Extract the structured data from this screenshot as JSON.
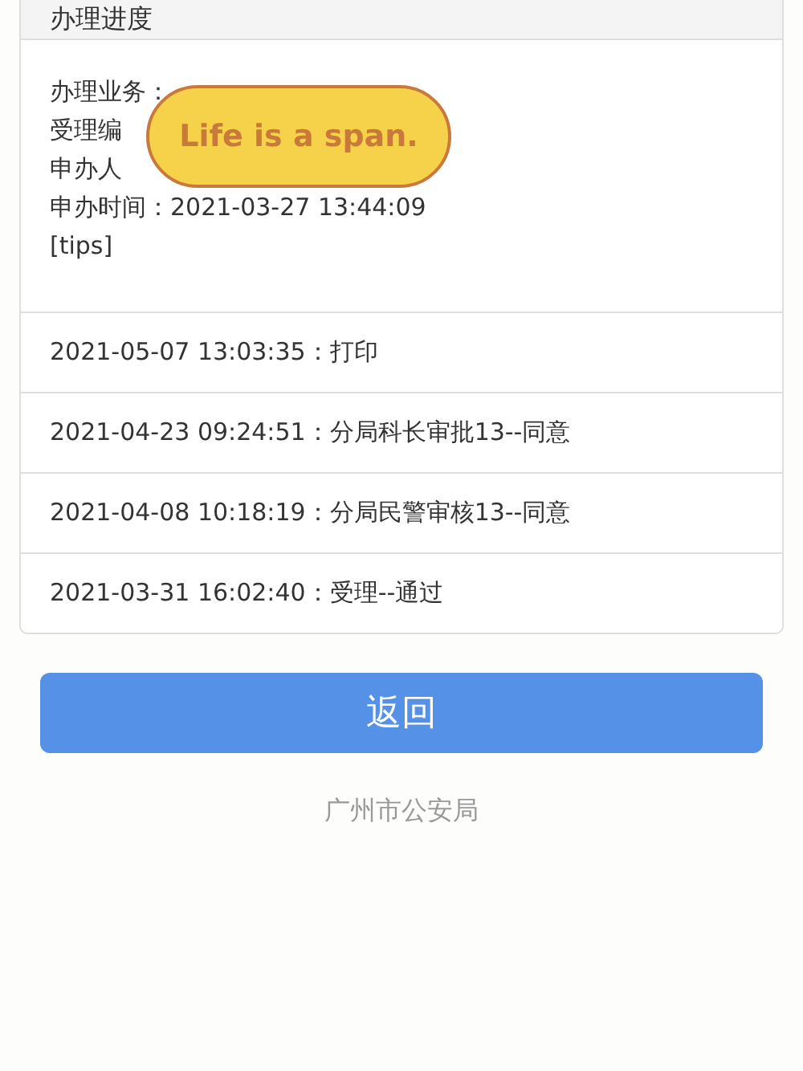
{
  "header": {
    "title": "办理进度"
  },
  "info_lines": [
    "办理业务：",
    "受理编",
    "申办人",
    "申办时间：2021-03-27 13:44:09",
    "[tips]"
  ],
  "sticker": {
    "text": "Life is a span."
  },
  "progress": [
    {
      "time": "2021-05-07 13:03:35：",
      "action": "打印"
    },
    {
      "time": "2021-04-23 09:24:51：",
      "action": "分局科长审批13--同意"
    },
    {
      "time": "2021-04-08 10:18:19：",
      "action": "分局民警审核13--同意"
    },
    {
      "time": "2021-03-31 16:02:40：",
      "action": "受理--通过"
    }
  ],
  "back_button": "返回",
  "footer": "广州市公安局"
}
